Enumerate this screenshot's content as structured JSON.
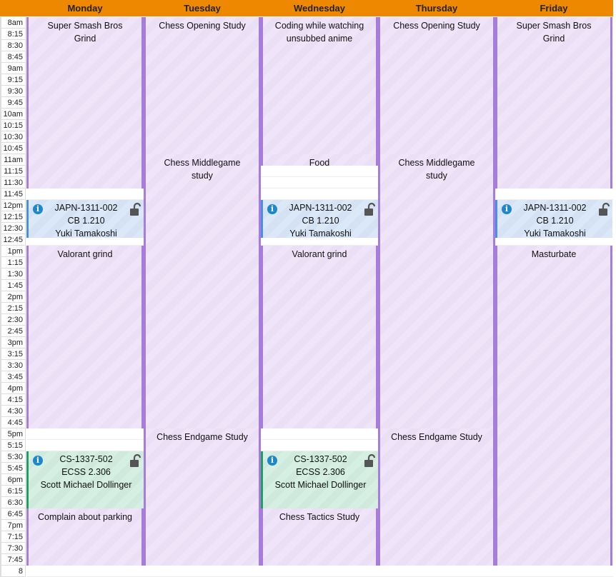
{
  "days": [
    "Monday",
    "Tuesday",
    "Wednesday",
    "Thursday",
    "Friday"
  ],
  "times": [
    "8am",
    "8:15",
    "8:30",
    "8:45",
    "9am",
    "9:15",
    "9:30",
    "9:45",
    "10am",
    "10:15",
    "10:30",
    "10:45",
    "11am",
    "11:15",
    "11:30",
    "11:45",
    "12pm",
    "12:15",
    "12:30",
    "12:45",
    "1pm",
    "1:15",
    "1:30",
    "1:45",
    "2pm",
    "2:15",
    "2:30",
    "2:45",
    "3pm",
    "3:15",
    "3:30",
    "3:45",
    "4pm",
    "4:15",
    "4:30",
    "4:45",
    "5pm",
    "5:15",
    "5:30",
    "5:45",
    "6pm",
    "6:15",
    "6:30",
    "6:45",
    "7pm",
    "7:15",
    "7:30",
    "7:45",
    "8"
  ],
  "colors": {
    "header": "#ee8800",
    "event_border": "#a77ddb",
    "class_blue": "#4a90e2",
    "class_green": "#20a060"
  },
  "events": [
    {
      "day": 0,
      "start": "8:00",
      "end": "11:45",
      "title": "Super Smash Bros Grind"
    },
    {
      "day": 0,
      "start": "12:00",
      "end": "12:50",
      "type": "class",
      "color": "blue",
      "title": "JAPN-1311-002",
      "room": "CB 1.210",
      "instructor": "Yuki Tamakoshi",
      "icon": "info-icon",
      "lock": "unlock-icon"
    },
    {
      "day": 0,
      "start": "13:00",
      "end": "17:00",
      "title": "Valorant grind"
    },
    {
      "day": 0,
      "start": "17:30",
      "end": "18:45",
      "type": "class",
      "color": "green",
      "title": "CS-1337-502",
      "room": "ECSS 2.306",
      "instructor": "Scott Michael Dollinger",
      "icon": "info-icon",
      "lock": "unlock-icon"
    },
    {
      "day": 0,
      "start": "18:45",
      "end": "20:00",
      "title": "Complain about parking"
    },
    {
      "day": 1,
      "start": "8:00",
      "end": "11:00",
      "title": "Chess Opening Study"
    },
    {
      "day": 1,
      "start": "11:00",
      "end": "17:00",
      "title": "Chess Middlegame study"
    },
    {
      "day": 1,
      "start": "17:00",
      "end": "20:00",
      "title": "Chess Endgame Study"
    },
    {
      "day": 2,
      "start": "8:00",
      "end": "11:00",
      "title": "Coding while watching unsubbed anime"
    },
    {
      "day": 2,
      "start": "11:00",
      "end": "11:15",
      "title": "Food"
    },
    {
      "day": 2,
      "start": "12:00",
      "end": "12:50",
      "type": "class",
      "color": "blue",
      "title": "JAPN-1311-002",
      "room": "CB 1.210",
      "instructor": "Yuki Tamakoshi",
      "icon": "info-icon",
      "lock": "unlock-icon"
    },
    {
      "day": 2,
      "start": "13:00",
      "end": "17:00",
      "title": "Valorant grind"
    },
    {
      "day": 2,
      "start": "17:30",
      "end": "18:45",
      "type": "class",
      "color": "green",
      "title": "CS-1337-502",
      "room": "ECSS 2.306",
      "instructor": "Scott Michael Dollinger",
      "icon": "info-icon",
      "lock": "unlock-icon"
    },
    {
      "day": 2,
      "start": "18:45",
      "end": "20:00",
      "title": "Chess Tactics Study"
    },
    {
      "day": 3,
      "start": "8:00",
      "end": "11:00",
      "title": "Chess Opening Study"
    },
    {
      "day": 3,
      "start": "11:00",
      "end": "17:00",
      "title": "Chess Middlegame study"
    },
    {
      "day": 3,
      "start": "17:00",
      "end": "20:00",
      "title": "Chess Endgame Study"
    },
    {
      "day": 4,
      "start": "8:00",
      "end": "11:45",
      "title": "Super Smash Bros Grind"
    },
    {
      "day": 4,
      "start": "12:00",
      "end": "12:50",
      "type": "class",
      "color": "blue",
      "title": "JAPN-1311-002",
      "room": "CB 1.210",
      "instructor": "Yuki Tamakoshi",
      "icon": "info-icon",
      "lock": "unlock-icon"
    },
    {
      "day": 4,
      "start": "13:00",
      "end": "20:00",
      "title": "Masturbate"
    }
  ]
}
